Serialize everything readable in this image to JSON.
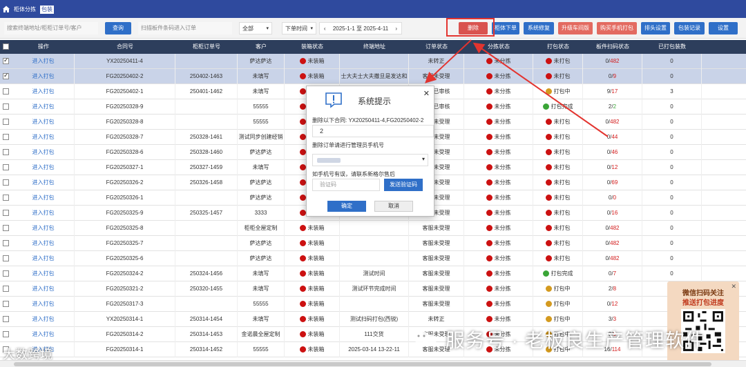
{
  "nav": {
    "tabs": [
      {
        "label": "柜体分拣",
        "active": false
      },
      {
        "label": "包装",
        "active": true
      }
    ]
  },
  "toolbar": {
    "search_address_placeholder": "搜索终端地址/柜柜订单号/客户",
    "query_label": "查询",
    "scan_placeholder": "扫描板件条码进入订单",
    "filter_all": "全部",
    "filter_time": "下单时间",
    "date_range": "2025-1-1 至 2025-4-11",
    "buttons": {
      "delete": "删除",
      "cabinet_order": "柜体下单",
      "system_repair": "系统修复",
      "upgrade_workshop": "升级车间版",
      "buy_handheld": "购买手机打包",
      "header_settings": "排头设置",
      "pack_record": "包装记录",
      "settings": "设置"
    }
  },
  "table": {
    "headers": [
      "操作",
      "合同号",
      "柜柜订单号",
      "客户",
      "装箱状态",
      "终端地址",
      "订单状态",
      "分拣状态",
      "打包状态",
      "板件扫码状态",
      "已打包装数"
    ],
    "action_label": "进入打包",
    "rows": [
      {
        "checked": true,
        "contract": "YX20250411-4",
        "order": "",
        "customer": "萨达萨达",
        "box": "未装箱",
        "address": "",
        "status": "未转正",
        "sort": "未分拣",
        "pack": "未打包",
        "pack_color": "red",
        "scan_done": "0",
        "scan_total": "482",
        "packed": "0"
      },
      {
        "checked": true,
        "contract": "FG20250402-2",
        "order": "250402-1463",
        "customer": "未填写",
        "box": "未装箱",
        "address": "士大夫士大夫撒旦是发达和",
        "status": "客服未受理",
        "sort": "未分拣",
        "pack": "未打包",
        "pack_color": "red",
        "scan_done": "0",
        "scan_total": "9",
        "packed": "0"
      },
      {
        "checked": false,
        "contract": "FG20250402-1",
        "order": "250401-1462",
        "customer": "未填写",
        "box": "未装箱",
        "address": "",
        "status": "拆单已审核",
        "sort": "未分拣",
        "pack": "打包中",
        "pack_color": "orange",
        "scan_done": "9",
        "scan_total": "17",
        "packed": "3"
      },
      {
        "checked": false,
        "contract": "FG20250328-9",
        "order": "",
        "customer": "55555",
        "box": "未装箱",
        "address": "",
        "status": "拆单已审核",
        "sort": "未分拣",
        "pack": "打包完成",
        "pack_color": "green",
        "scan_done": "2",
        "scan_total": "2",
        "packed": "0",
        "total_green": true
      },
      {
        "checked": false,
        "contract": "FG20250328-8",
        "order": "",
        "customer": "55555",
        "box": "未装箱",
        "address": "",
        "status": "客服未受理",
        "sort": "未分拣",
        "pack": "未打包",
        "pack_color": "red",
        "scan_done": "0",
        "scan_total": "482",
        "packed": "0"
      },
      {
        "checked": false,
        "contract": "FG20250328-7",
        "order": "250328-1461",
        "customer": "测试同步创建经销",
        "box": "未装箱",
        "address": "",
        "status": "客服未受理",
        "sort": "未分拣",
        "pack": "未打包",
        "pack_color": "red",
        "scan_done": "0",
        "scan_total": "44",
        "packed": "0"
      },
      {
        "checked": false,
        "contract": "FG20250328-6",
        "order": "250328-1460",
        "customer": "萨达萨达",
        "box": "未装箱",
        "address": "",
        "status": "客服未受理",
        "sort": "未分拣",
        "pack": "未打包",
        "pack_color": "red",
        "scan_done": "0",
        "scan_total": "46",
        "packed": "0"
      },
      {
        "checked": false,
        "contract": "FG20250327-1",
        "order": "250327-1459",
        "customer": "未填写",
        "box": "未装箱",
        "address": "",
        "status": "客服未受理",
        "sort": "未分拣",
        "pack": "未打包",
        "pack_color": "red",
        "scan_done": "0",
        "scan_total": "12",
        "packed": "0"
      },
      {
        "checked": false,
        "contract": "FG20250326-2",
        "order": "250326-1458",
        "customer": "萨达萨达",
        "box": "未装箱",
        "address": "",
        "status": "客服未受理",
        "sort": "未分拣",
        "pack": "未打包",
        "pack_color": "red",
        "scan_done": "0",
        "scan_total": "69",
        "packed": "0"
      },
      {
        "checked": false,
        "contract": "FG20250326-1",
        "order": "",
        "customer": "萨达萨达",
        "box": "未装箱",
        "address": "",
        "status": "客服未受理",
        "sort": "未分拣",
        "pack": "未打包",
        "pack_color": "red",
        "scan_done": "0",
        "scan_total": "0",
        "packed": "0"
      },
      {
        "checked": false,
        "contract": "FG20250325-9",
        "order": "250325-1457",
        "customer": "3333",
        "box": "未装箱",
        "address": "",
        "status": "客服未受理",
        "sort": "未分拣",
        "pack": "未打包",
        "pack_color": "red",
        "scan_done": "0",
        "scan_total": "16",
        "packed": "0"
      },
      {
        "checked": false,
        "contract": "FG20250325-8",
        "order": "",
        "customer": "柜柜全屋定制",
        "box": "未装箱",
        "address": "",
        "status": "客服未受理",
        "sort": "未分拣",
        "pack": "未打包",
        "pack_color": "red",
        "scan_done": "0",
        "scan_total": "482",
        "packed": "0"
      },
      {
        "checked": false,
        "contract": "FG20250325-7",
        "order": "",
        "customer": "萨达萨达",
        "box": "未装箱",
        "address": "",
        "status": "客服未受理",
        "sort": "未分拣",
        "pack": "未打包",
        "pack_color": "red",
        "scan_done": "0",
        "scan_total": "482",
        "packed": "0"
      },
      {
        "checked": false,
        "contract": "FG20250325-6",
        "order": "",
        "customer": "萨达萨达",
        "box": "未装箱",
        "address": "",
        "status": "客服未受理",
        "sort": "未分拣",
        "pack": "未打包",
        "pack_color": "red",
        "scan_done": "0",
        "scan_total": "482",
        "packed": "0"
      },
      {
        "checked": false,
        "contract": "FG20250324-2",
        "order": "250324-1456",
        "customer": "未填写",
        "box": "未装箱",
        "address": "测试时间",
        "status": "客服未受理",
        "sort": "未分拣",
        "pack": "打包完成",
        "pack_color": "green",
        "scan_done": "0",
        "scan_total": "7",
        "packed": "0"
      },
      {
        "checked": false,
        "contract": "FG20250321-2",
        "order": "250320-1455",
        "customer": "未填写",
        "box": "未装箱",
        "address": "测试环节完成时间",
        "status": "客服未受理",
        "sort": "未分拣",
        "pack": "打包中",
        "pack_color": "orange",
        "scan_done": "2",
        "scan_total": "8",
        "packed": "0"
      },
      {
        "checked": false,
        "contract": "FG20250317-3",
        "order": "",
        "customer": "55555",
        "box": "未装箱",
        "address": "",
        "status": "客服未受理",
        "sort": "未分拣",
        "pack": "打包中",
        "pack_color": "orange",
        "scan_done": "0",
        "scan_total": "12",
        "packed": "0"
      },
      {
        "checked": false,
        "contract": "YX20250314-1",
        "order": "250314-1454",
        "customer": "未填写",
        "box": "未装箱",
        "address": "测试扫码打包(西锐)",
        "status": "未转正",
        "sort": "未分拣",
        "pack": "打包中",
        "pack_color": "orange",
        "scan_done": "3",
        "scan_total": "3",
        "packed": "0"
      },
      {
        "checked": false,
        "contract": "FG20250314-2",
        "order": "250314-1453",
        "customer": "金诺晨全屋定制",
        "box": "未装箱",
        "address": "111交货",
        "status": "客服未受理",
        "sort": "未分拣",
        "pack": "打包中",
        "pack_color": "orange",
        "scan_done": "0",
        "scan_total": "9",
        "packed": "0"
      },
      {
        "checked": false,
        "contract": "FG20250314-1",
        "order": "250314-1452",
        "customer": "55555",
        "box": "未装箱",
        "address": "2025-03-14 13-22-11",
        "status": "客服未受理",
        "sort": "未分拣",
        "pack": "打包中",
        "pack_color": "orange",
        "scan_done": "16",
        "scan_total": "114",
        "packed": "0"
      }
    ]
  },
  "modal": {
    "title": "系统提示",
    "delete_prefix": "删除以下合同: YX20250411-4,FG20250402-2",
    "contract_tail": "2",
    "phone_prompt": "删除订单请进行管理员手机号",
    "wrong_phone_hint": "如手机号有误，请联系新格尔售后",
    "code_placeholder": "验证码",
    "send_code": "发送验证码",
    "ok": "确定",
    "cancel": "取消"
  },
  "qr_promo": {
    "line1": "微信扫码关注",
    "line2": "推送打包进度"
  },
  "watermark": {
    "left": "大数跨境",
    "right": "服务号 · 老板良生产管理软件"
  },
  "colors": {
    "topbar": "#2f4a9e",
    "header": "#2d3e5c",
    "accent": "#2f6fc8",
    "danger": "#d9534f",
    "dot_red": "#cc1111",
    "dot_orange": "#d49a1f",
    "dot_green": "#3aa537"
  }
}
